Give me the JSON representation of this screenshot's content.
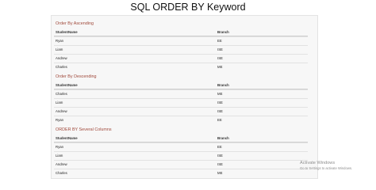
{
  "page": {
    "title": "SQL ORDER BY Keyword"
  },
  "sections": [
    {
      "title": "Order By Ascending",
      "columns": [
        "StudentName",
        "Branch"
      ],
      "rows": [
        [
          "Ryan",
          "EE"
        ],
        [
          "Liam",
          "ISE"
        ],
        [
          "Andrew",
          "ISE"
        ],
        [
          "Charles",
          "ME"
        ]
      ]
    },
    {
      "title": "Order By Descending",
      "columns": [
        "StudentName",
        "Branch"
      ],
      "rows": [
        [
          "Charles",
          "ME"
        ],
        [
          "Liam",
          "ISE"
        ],
        [
          "Andrew",
          "ISE"
        ],
        [
          "Ryan",
          "EE"
        ]
      ]
    },
    {
      "title": "ORDER BY Several Columns",
      "columns": [
        "StudentName",
        "Branch"
      ],
      "rows": [
        [
          "Ryan",
          "EE"
        ],
        [
          "Liam",
          "ISE"
        ],
        [
          "Andrew",
          "ISE"
        ],
        [
          "Charles",
          "ME"
        ]
      ]
    }
  ],
  "watermark": {
    "title": "Activate Windows",
    "subtitle": "Go to Settings to activate Windows."
  },
  "colors": {
    "section_title": "#a0493b",
    "panel_background": "#f7f7f7"
  }
}
